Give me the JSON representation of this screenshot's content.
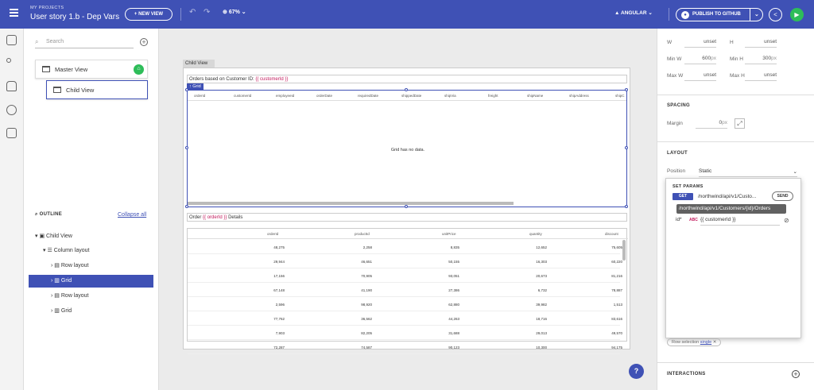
{
  "topbar": {
    "section": "MY PROJECTS",
    "project_title": "User story 1.b - Dep Vars",
    "new_view": "+ NEW VIEW",
    "zoom": "67%",
    "framework": "ANGULAR",
    "publish": "PUBLISH TO GITHUB"
  },
  "left": {
    "search_placeholder": "Search",
    "views": [
      "Master View",
      "Child View"
    ],
    "outline_title": "OUTLINE",
    "collapse_all": "Collapse all",
    "tree": [
      "Child View",
      "Column layout",
      "Row layout",
      "Grid",
      "Row layout",
      "Grid"
    ]
  },
  "canvas": {
    "tab": "Child View",
    "label1_prefix": "Orders based on Customer ID:",
    "label1_var": "{{ customerId }}",
    "grid_tag": "Grid",
    "grid1_columns": [
      "orderId",
      "customerId",
      "employeeId",
      "orderDate",
      "requiredDate",
      "shippedDate",
      "shipVia",
      "freight",
      "shipName",
      "shipAddress",
      "shipC"
    ],
    "nodata": "Grid has no data.",
    "label2_prefix": "Order",
    "label2_var": "{{ orderId }}",
    "label2_suffix": "Details",
    "grid2_columns": [
      "orderId",
      "productId",
      "unitPrice",
      "quantity",
      "discount"
    ],
    "grid2_rows": [
      [
        "48,275",
        "2,258",
        "8,835",
        "12,652",
        "75,605"
      ],
      [
        "29,944",
        "46,651",
        "50,155",
        "16,303",
        "60,220"
      ],
      [
        "17,156",
        "70,905",
        "93,051",
        "20,673",
        "81,216"
      ],
      [
        "67,148",
        "41,190",
        "27,386",
        "6,732",
        "78,887"
      ],
      [
        "2,596",
        "98,920",
        "62,880",
        "39,982",
        "1,513"
      ],
      [
        "77,762",
        "36,562",
        "44,263",
        "18,716",
        "83,616"
      ],
      [
        "7,903",
        "82,205",
        "31,688",
        "29,013",
        "49,570"
      ],
      [
        "72,287",
        "74,587",
        "90,123",
        "10,300",
        "94,175"
      ]
    ]
  },
  "right": {
    "w": "W",
    "w_val": "unset",
    "h": "H",
    "h_val": "unset",
    "minw": "Min W",
    "minw_val": "600",
    "minh": "Min H",
    "minh_val": "300",
    "px": "px",
    "maxw": "Max W",
    "maxw_val": "unset",
    "maxh": "Max H",
    "maxh_val": "unset",
    "spacing": "SPACING",
    "margin": "Margin",
    "margin_val": "0",
    "layout": "LAYOUT",
    "position": "Position",
    "position_val": "Static",
    "set_params": "SET PARAMS",
    "get": "GET",
    "url": "/northwind/api/v1/Custo...",
    "send": "SEND",
    "tooltip": "/northwind/api/v1/Customers/{id}/Orders",
    "id_label": "id*",
    "abc": "ABC",
    "id_val": "{{ customerId }}",
    "row_selection": "Row selection",
    "row_selection_val": "single",
    "interactions": "INTERACTIONS"
  },
  "help": "?"
}
